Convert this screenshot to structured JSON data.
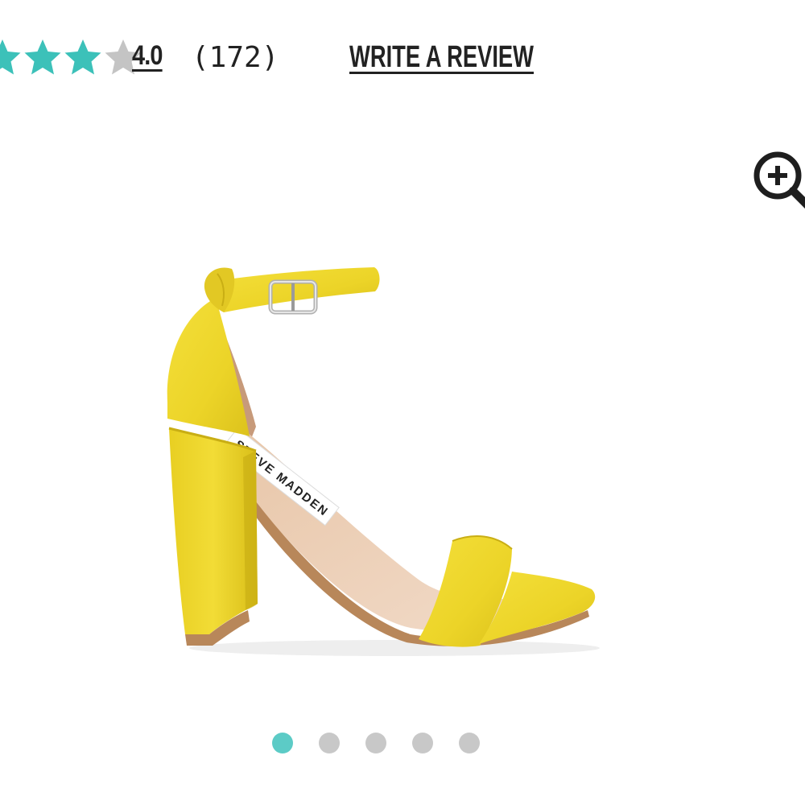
{
  "rating": {
    "value": "4.0",
    "count": "(172)",
    "stars_filled": 4,
    "stars_total": 5,
    "filled_color": "#3cc1b9",
    "empty_color": "#c4c4c4"
  },
  "actions": {
    "write_review_label": "WRITE A REVIEW",
    "zoom_icon": "zoom-in-magnifier"
  },
  "product": {
    "image_icon": "yellow-block-heel-ankle-strap-sandal",
    "brand_insole_text": "STEVE MADDEN",
    "color": "#f0d92e"
  },
  "carousel": {
    "total": 5,
    "active_index": 0,
    "active_color": "#5ccbc6",
    "inactive_color": "#c8c8c8"
  }
}
